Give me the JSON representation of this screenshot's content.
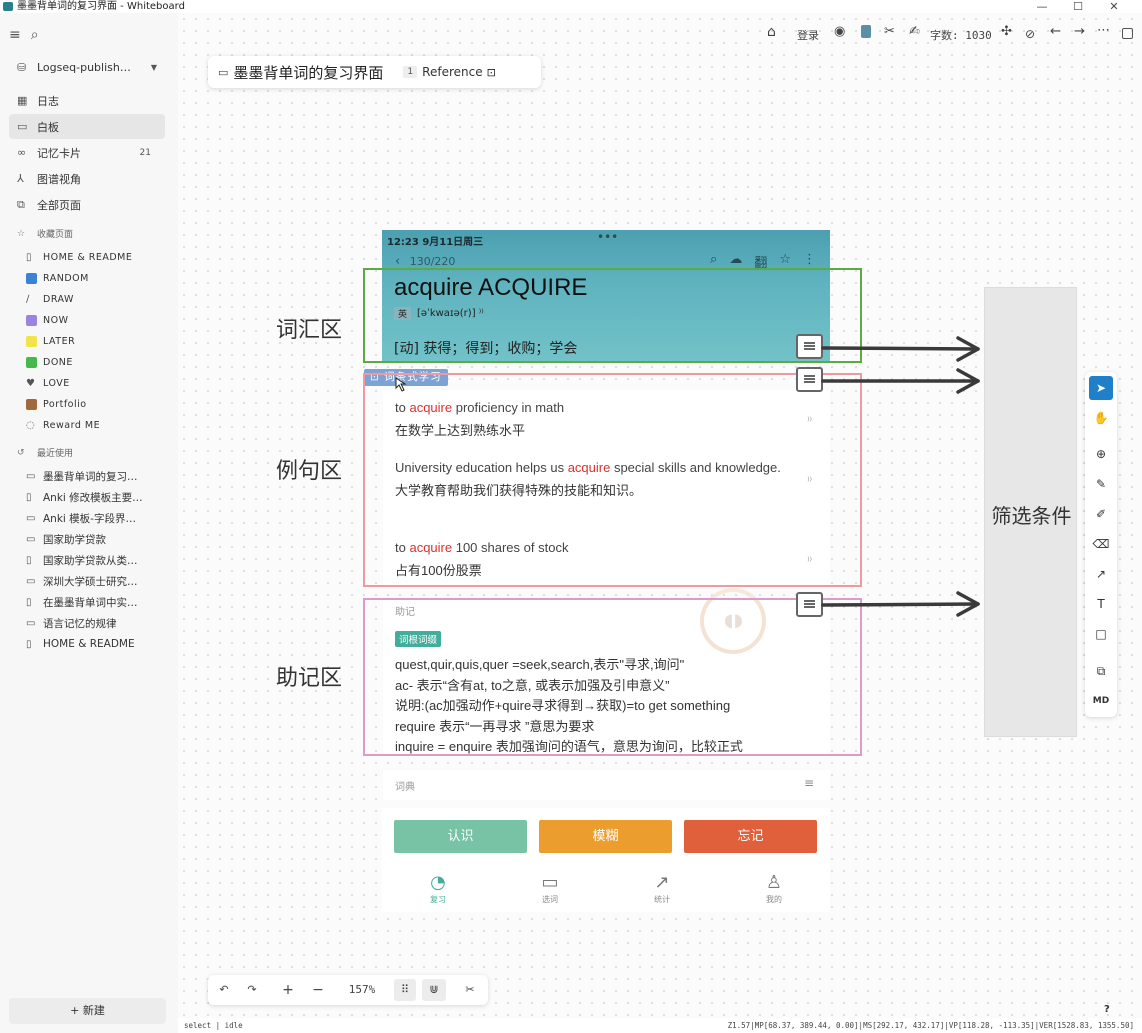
{
  "window": {
    "title": "墨墨背单词的复习界面 - Whiteboard",
    "controls": [
      "—",
      "☐",
      "✕"
    ]
  },
  "sidebar": {
    "graph_name": "Logseq-publish…",
    "nav": [
      {
        "label": "日志",
        "icon": "calendar-icon",
        "glyph": "▦"
      },
      {
        "label": "白板",
        "icon": "whiteboard-icon",
        "glyph": "▭"
      },
      {
        "label": "记忆卡片",
        "icon": "flashcards-icon",
        "glyph": "∞",
        "count": "21"
      },
      {
        "label": "图谱视角",
        "icon": "graph-icon",
        "glyph": "⅄"
      },
      {
        "label": "全部页面",
        "icon": "all-pages-icon",
        "glyph": "⧉"
      }
    ],
    "favorites_title": "收藏页面",
    "favorites": [
      {
        "label": "HOME & README",
        "icon": "page-icon",
        "glyph": "▯"
      },
      {
        "label": "RANDOM",
        "icon": "random-icon",
        "color": "#3a82d6"
      },
      {
        "label": "DRAW",
        "icon": "draw-icon",
        "glyph": "∕"
      },
      {
        "label": "NOW",
        "icon": "now-icon",
        "color": "#9a84e0"
      },
      {
        "label": "LATER",
        "icon": "later-icon",
        "color": "#f4e24a"
      },
      {
        "label": "DONE",
        "icon": "done-icon",
        "color": "#47b94a"
      },
      {
        "label": "LOVE",
        "icon": "heart-icon",
        "glyph": "♥"
      },
      {
        "label": "Portfolio",
        "icon": "briefcase-icon",
        "color": "#a0683c"
      },
      {
        "label": "Reward ME",
        "icon": "bulb-icon",
        "glyph": "◌"
      }
    ],
    "recent_title": "最近使用",
    "recent": [
      {
        "label": "墨墨背单词的复习…",
        "glyph": "▭"
      },
      {
        "label": "Anki 修改模板主要…",
        "glyph": "▯"
      },
      {
        "label": "Anki 模板-字段界…",
        "glyph": "▭"
      },
      {
        "label": "国家助学贷款",
        "glyph": "▭"
      },
      {
        "label": "国家助学贷款从类…",
        "glyph": "▯"
      },
      {
        "label": "深圳大学硕士研究…",
        "glyph": "▭"
      },
      {
        "label": "在墨墨背单词中实…",
        "glyph": "▯"
      },
      {
        "label": "语言记忆的规律",
        "glyph": "▭"
      },
      {
        "label": "HOME & README",
        "glyph": "▯"
      }
    ],
    "new_button": "+ 新建"
  },
  "topbar": {
    "login": "登录",
    "word_count": "字数: 1030"
  },
  "doc": {
    "title": "墨墨背单词的复习界面",
    "ref_count": "1",
    "ref_label": "Reference"
  },
  "zones": {
    "vocab": "词汇区",
    "example": "例句区",
    "mnemonic": "助记区",
    "filter": "筛选条件"
  },
  "phone": {
    "time": "12:23  9月11日周三",
    "progress": "130/220",
    "word": "acquire ACQUIRE",
    "lang": "英",
    "phonetic": "[əˈkwaɪə(r)] ⁾⁾",
    "definition": "[动] 获得；得到；收购；学会",
    "tag": "词条式学习",
    "examples": [
      {
        "pre": "to ",
        "hl": "acquire",
        "post": " proficiency in math",
        "zh": "在数学上达到熟练水平"
      },
      {
        "pre": "University education helps us ",
        "hl": "acquire",
        "post": " special skills and knowledge.",
        "zh": "大学教育帮助我们获得特殊的技能和知识。"
      },
      {
        "pre": "to ",
        "hl": "acquire",
        "post": " 100 shares of stock",
        "zh": "占有100份股票"
      }
    ],
    "memo_heading": "助记",
    "memo_tag": "词根词缀",
    "memo_lines": [
      "quest,quir,quis,quer    =seek,search,表示\"寻求,询问\"",
      "ac-    表示“含有at, to之意, 或表示加强及引申意义”",
      "说明:(ac加强动作+quire寻求得到→获取)=to get something",
      "require 表示“一再寻求 ”意思为要求",
      "inquire = enquire 表加强询问的语气，意思为询问，比较正式"
    ],
    "dict_label": "词典",
    "buttons": [
      {
        "label": "认识",
        "color": "#78c3a6"
      },
      {
        "label": "模糊",
        "color": "#eb9d2e"
      },
      {
        "label": "忘记",
        "color": "#e0603c"
      }
    ],
    "tabs": [
      {
        "label": "复习",
        "icon": "review-icon",
        "glyph": "◔"
      },
      {
        "label": "选词",
        "icon": "select-words-icon",
        "glyph": "▭"
      },
      {
        "label": "统计",
        "icon": "stats-icon",
        "glyph": "↗"
      },
      {
        "label": "我的",
        "icon": "profile-icon",
        "glyph": "♙"
      }
    ]
  },
  "zoom": "157%",
  "status": {
    "left": "select | idle",
    "right": "Z1.57|MP[68.37, 389.44, 0.00]|MS[292.17, 432.17]|VP[118.28, -113.35]|VER[1528.83, 1355.50]"
  },
  "help": "?"
}
